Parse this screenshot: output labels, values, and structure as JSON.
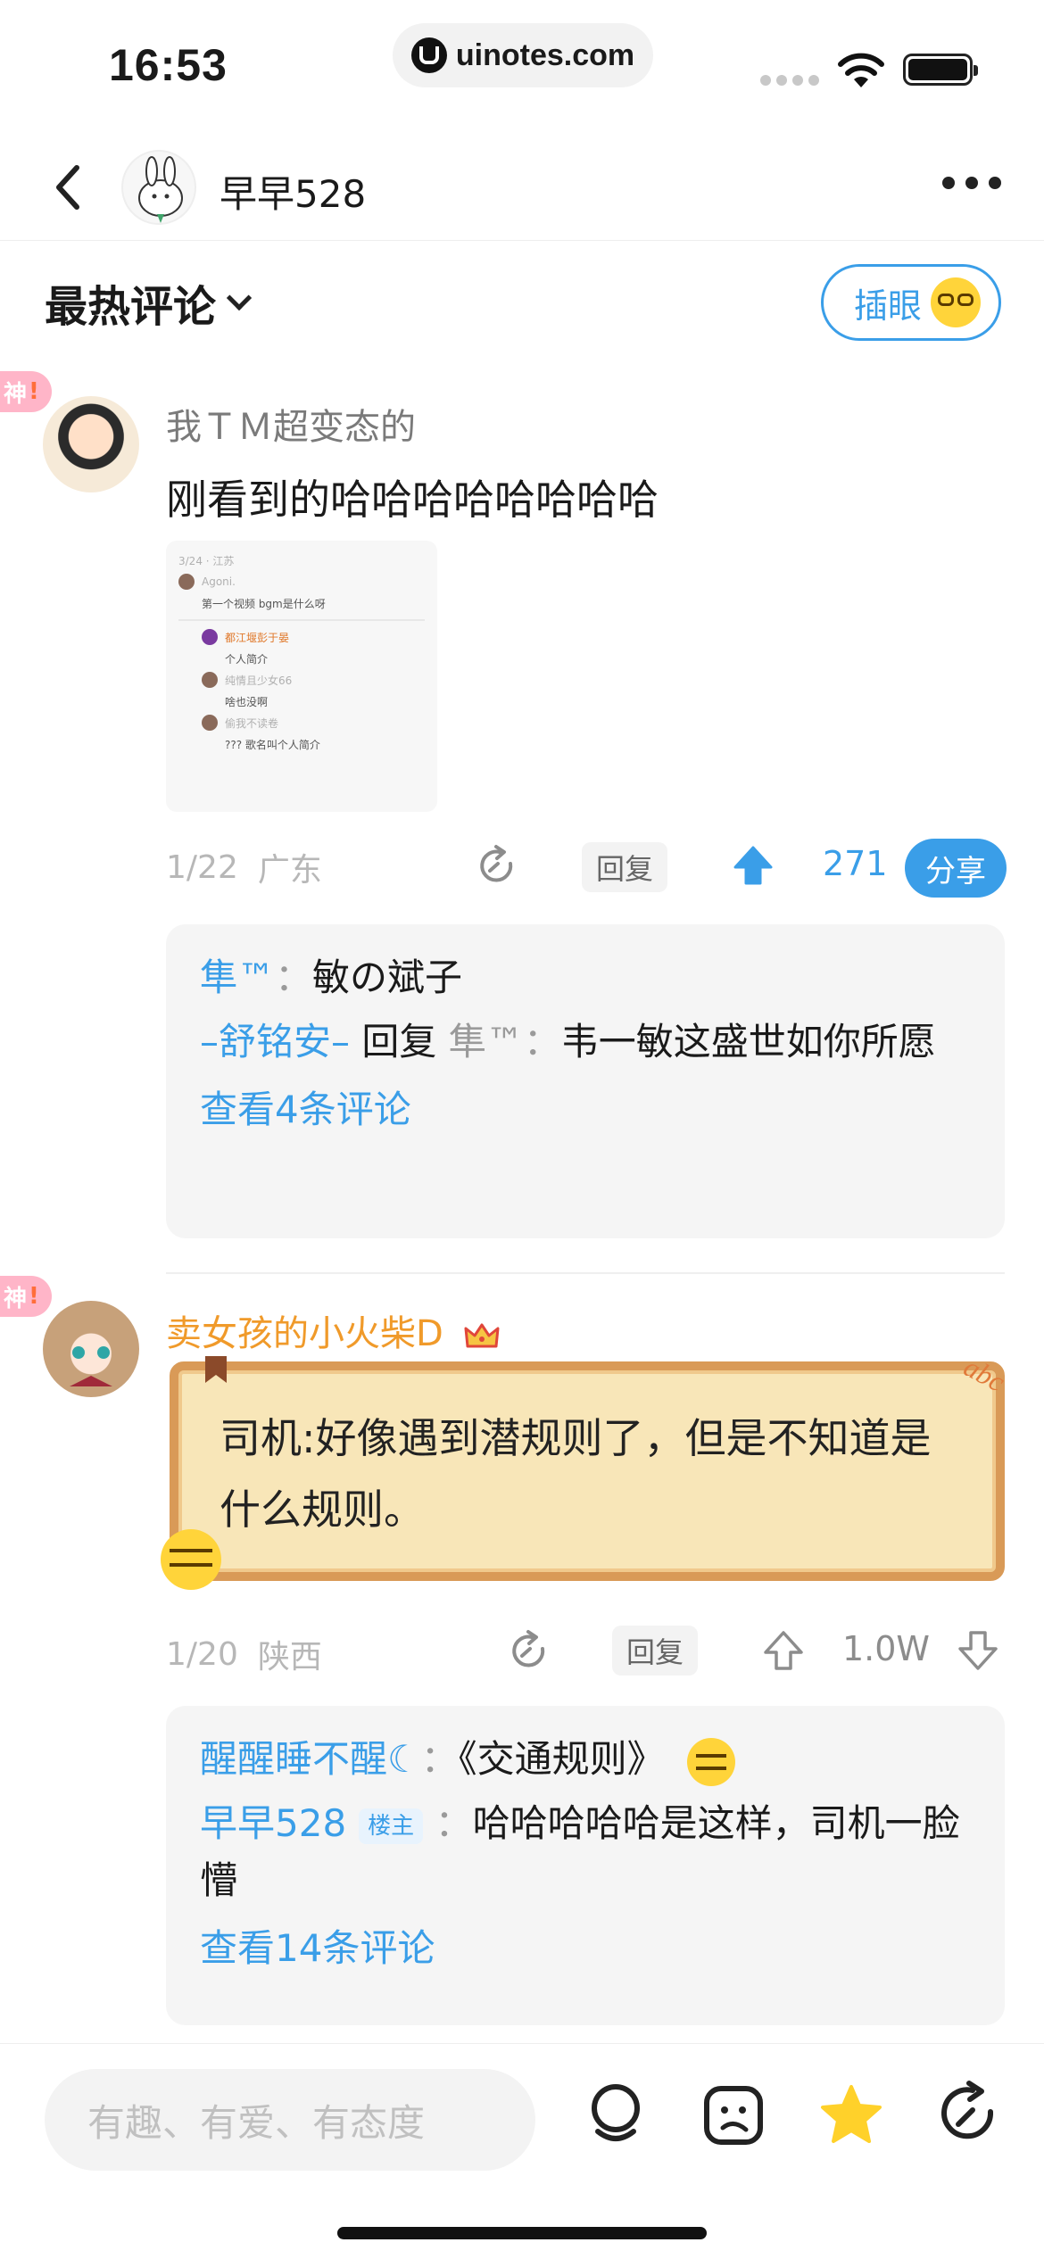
{
  "status": {
    "time": "16:53",
    "url": "uinotes.com"
  },
  "nav": {
    "title": "早早528"
  },
  "sort": {
    "label": "最热评论",
    "insert_label": "插眼"
  },
  "comments": [
    {
      "badge": "神",
      "user": "我ＴＭ超变态的",
      "content": "刚看到的哈哈哈哈哈哈哈哈",
      "date": "1/22",
      "location": "广东",
      "reply_label": "回复",
      "likes": "271",
      "share_label": "分享",
      "thumb_rows": [
        {
          "name": "Agoni.",
          "text": "第一个视频 bgm是什么呀"
        },
        {
          "name": "都江堰彭于晏",
          "text": "个人简介"
        },
        {
          "name": "纯情且少女66",
          "text": "啥也没啊"
        },
        {
          "name": "偷我不读卷",
          "text": "??? 歌名叫个人简介"
        }
      ],
      "replies": [
        {
          "name": "隼™",
          "sep": "：",
          "text": "敏の斌子"
        },
        {
          "name": "–舒铭安–",
          "verb": "回复",
          "target": "隼™",
          "sep": "：",
          "text": "韦一敏这盛世如你所愿"
        }
      ],
      "more_label": "查看4条评论"
    },
    {
      "badge": "神",
      "user": "卖女孩的小火柴D",
      "content": "司机:好像遇到潜规则了，但是不知道是什么规则。",
      "scroll_decor": "abc",
      "date": "1/20",
      "location": "陕西",
      "reply_label": "回复",
      "likes": "1.0W",
      "replies": [
        {
          "name": "醒醒睡不醒☾",
          "sep": "：",
          "text": "《交通规则》"
        },
        {
          "name": "早早528",
          "tag": "楼主",
          "sep": "：",
          "text": "哈哈哈哈哈是这样，司机一脸懵"
        }
      ],
      "more_label": "查看14条评论"
    }
  ],
  "bottom": {
    "placeholder": "有趣、有爱、有态度"
  },
  "colors": {
    "accent": "#3a9ee8",
    "gold_name": "#f09a2a",
    "bubble_fill": "#f8e6b8",
    "bubble_border": "#d99a57"
  }
}
